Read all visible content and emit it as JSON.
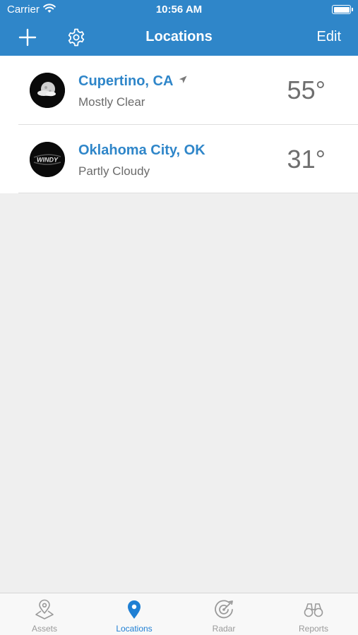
{
  "status_bar": {
    "carrier": "Carrier",
    "time": "10:56 AM"
  },
  "nav": {
    "title": "Locations",
    "edit_label": "Edit"
  },
  "locations": [
    {
      "city": "Cupertino, CA",
      "condition": "Mostly Clear",
      "temp": "55°",
      "current_location": true,
      "thumb_text": ""
    },
    {
      "city": "Oklahoma City, OK",
      "condition": "Partly Cloudy",
      "temp": "31°",
      "current_location": false,
      "thumb_text": "WINDY"
    }
  ],
  "tabs": [
    {
      "label": "Assets",
      "icon": "map-pin-outline-icon",
      "active": false
    },
    {
      "label": "Locations",
      "icon": "location-pin-icon",
      "active": true
    },
    {
      "label": "Radar",
      "icon": "radar-icon",
      "active": false
    },
    {
      "label": "Reports",
      "icon": "binoculars-icon",
      "active": false
    }
  ],
  "colors": {
    "header": "#2f86c9",
    "accent": "#1f7fd3",
    "inactive": "#9a9a9a"
  }
}
